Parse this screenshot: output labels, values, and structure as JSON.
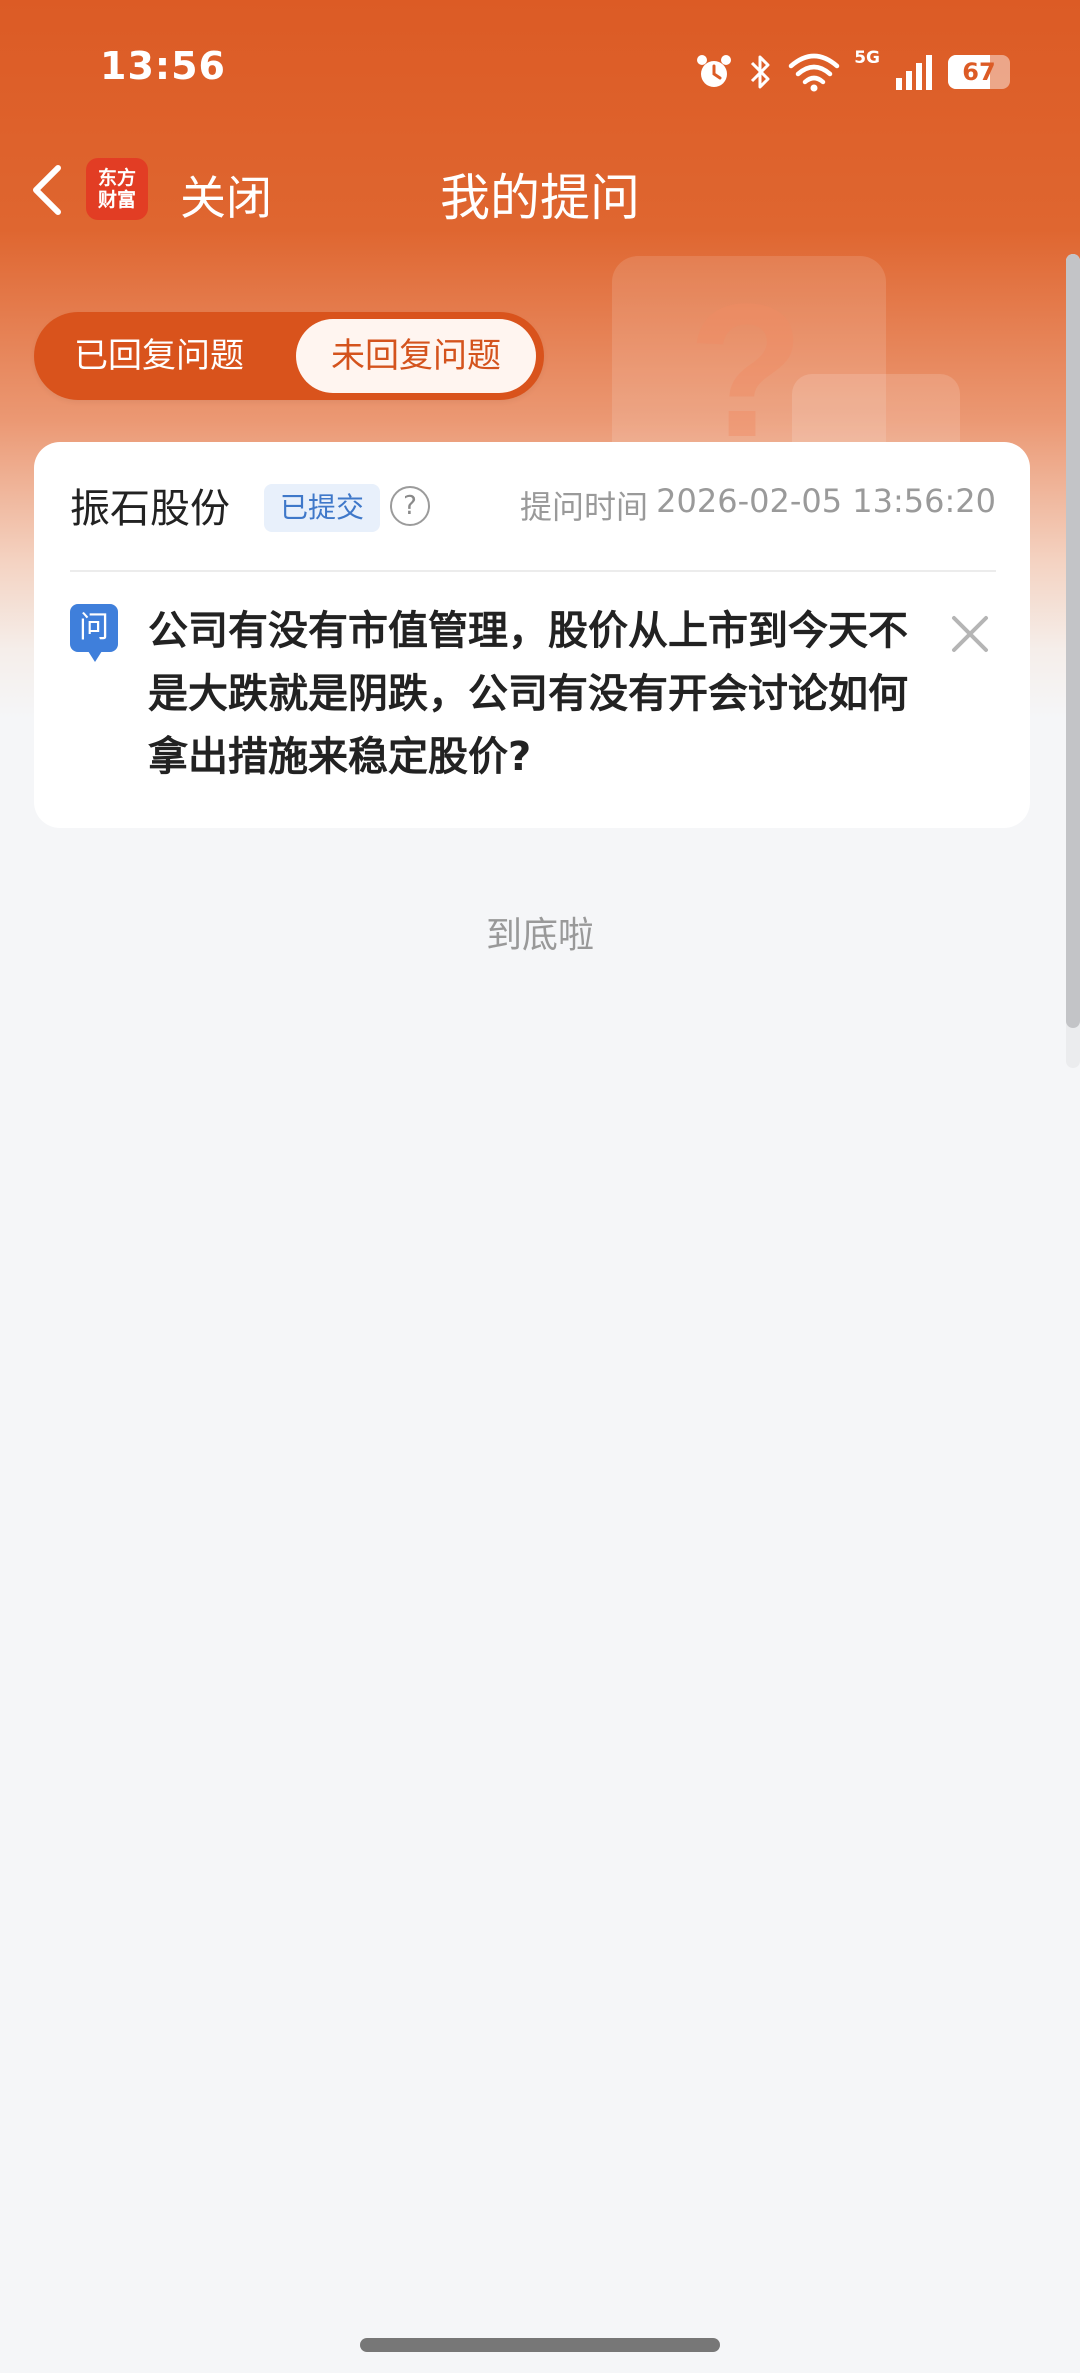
{
  "status_bar": {
    "time": "13:56",
    "network": "5G",
    "battery": "67",
    "battery_level": 0.67,
    "icons": [
      "alarm-icon",
      "bluetooth-icon",
      "wifi-icon",
      "cellular-icon",
      "battery-icon"
    ]
  },
  "nav": {
    "logo_line1": "东方",
    "logo_line2": "财富",
    "close_label": "关闭",
    "title": "我的提问"
  },
  "tabs": [
    {
      "label": "已回复问题",
      "selected": false
    },
    {
      "label": "未回复问题",
      "selected": true
    }
  ],
  "question_card": {
    "company": "振石股份",
    "status_badge": "已提交",
    "help_symbol": "?",
    "time_label": "提问时间",
    "time": "2026-02-05 13:56:20",
    "q_icon_label": "问",
    "question": "公司有没有市值管理，股价从上市到今天不是大跌就是阴跌，公司有没有开会讨论如何拿出措施来稳定股价?"
  },
  "end_text": "到底啦",
  "colors": {
    "brand": "#dc5b25",
    "tab_active_text": "#d4531d",
    "badge_blue": "#3f78c9",
    "q_icon": "#3f7fdb",
    "background": "#f5f6f8"
  }
}
